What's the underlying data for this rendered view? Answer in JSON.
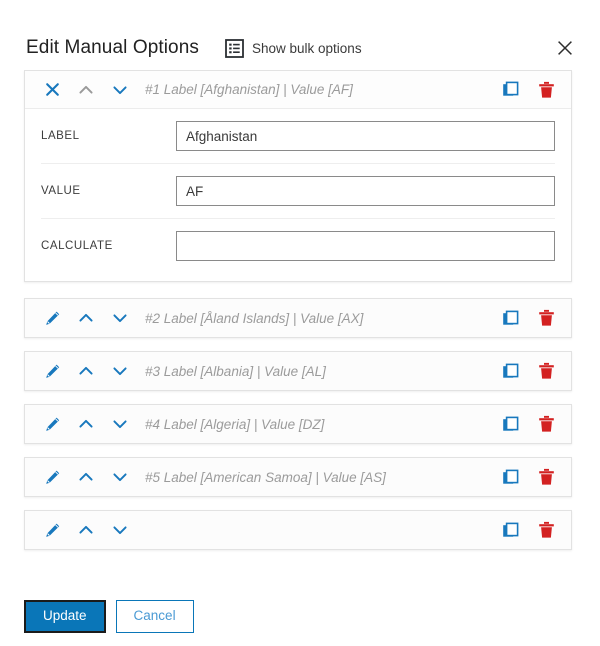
{
  "header": {
    "title": "Edit Manual Options",
    "bulk_toggle_label": "Show bulk options",
    "bulk_icon": "list-table-icon",
    "close_icon": "close-icon"
  },
  "options": [
    {
      "summary": "#1 Label [Afghanistan] | Value [AF]",
      "expanded": true,
      "lead_icon": "close-icon",
      "move_up_enabled": false,
      "move_down_enabled": true,
      "fields": [
        {
          "label": "LABEL",
          "value": "Afghanistan",
          "placeholder": ""
        },
        {
          "label": "VALUE",
          "value": "AF",
          "placeholder": ""
        },
        {
          "label": "CALCULATE",
          "value": "",
          "placeholder": ""
        }
      ]
    },
    {
      "summary": "#2 Label [Åland Islands] | Value [AX]",
      "expanded": false,
      "lead_icon": "pencil-icon",
      "move_up_enabled": true,
      "move_down_enabled": true,
      "fields": []
    },
    {
      "summary": "#3 Label [Albania] | Value [AL]",
      "expanded": false,
      "lead_icon": "pencil-icon",
      "move_up_enabled": true,
      "move_down_enabled": true,
      "fields": []
    },
    {
      "summary": "#4 Label [Algeria] | Value [DZ]",
      "expanded": false,
      "lead_icon": "pencil-icon",
      "move_up_enabled": true,
      "move_down_enabled": true,
      "fields": []
    },
    {
      "summary": "#5 Label [American Samoa] | Value [AS]",
      "expanded": false,
      "lead_icon": "pencil-icon",
      "move_up_enabled": true,
      "move_down_enabled": true,
      "fields": []
    },
    {
      "summary": "",
      "expanded": false,
      "lead_icon": "pencil-icon",
      "move_up_enabled": true,
      "move_down_enabled": true,
      "fields": []
    }
  ],
  "row_icons": {
    "duplicate": "copy-icon",
    "delete": "trash-icon",
    "move_up": "chevron-up-icon",
    "move_down": "chevron-down-icon"
  },
  "footer": {
    "update_label": "Update",
    "cancel_label": "Cancel"
  },
  "colors": {
    "accent_blue": "#0a76b8",
    "icon_blue": "#1878bd",
    "delete_red": "#d32121",
    "disabled_gray": "#9a9a9a",
    "summary_gray": "#9b9b9b",
    "title_dark": "#222222"
  }
}
